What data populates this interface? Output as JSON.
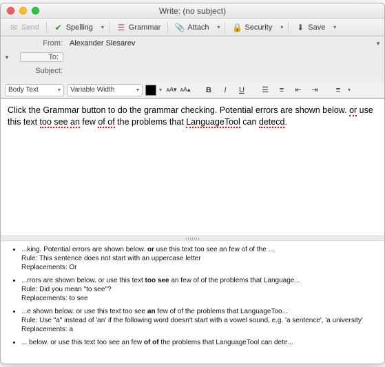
{
  "window": {
    "title": "Write: (no subject)"
  },
  "toolbar": {
    "send": "Send",
    "spelling": "Spelling",
    "grammar": "Grammar",
    "attach": "Attach",
    "security": "Security",
    "save": "Save"
  },
  "headers": {
    "from_label": "From:",
    "from_value": "Alexander Slesarev",
    "to_label": "To:",
    "to_value": "",
    "subject_label": "Subject:",
    "subject_value": ""
  },
  "formatbar": {
    "para_style": "Body Text",
    "font_family": "Variable Width"
  },
  "body": {
    "line1_a": "Click the Grammar button to do the grammar checking. Potential errors are shown below. ",
    "line2_a": "or",
    "line2_b": " use this text ",
    "line2_c": "too see",
    "line2_d": " ",
    "line2_e": "an",
    "line2_f": " few ",
    "line2_g": "of of",
    "line2_h": " the problems that ",
    "line2_i": "LanguageTool",
    "line2_j": " can ",
    "line2_k": "detecd",
    "line2_l": "."
  },
  "issues": [
    {
      "pre": "...king. Potential errors are shown below. ",
      "hl": "or",
      "post": " use this text too see an few of of the ...",
      "rule": "Rule: This sentence does not start with an uppercase letter",
      "repl": "Replacements: Or"
    },
    {
      "pre": "...rrors are shown below. or use this text ",
      "hl": "too see",
      "post": " an few of of the problems that Language...",
      "rule": "Rule: Did you mean \"to see\"?",
      "repl": "Replacements: to see"
    },
    {
      "pre": "...e shown below. or use this text too see ",
      "hl": "an",
      "post": " few of of the problems that LanguageToo...",
      "rule": "Rule: Use \"a\" instead of 'an' if the following word doesn't start with a vowel sound, e.g. 'a sentence', 'a university'",
      "repl": "Replacements: a"
    },
    {
      "pre": "... below. or use this text too see an few ",
      "hl": "of of",
      "post": " the problems that LanguageTool can dete...",
      "rule": "",
      "repl": ""
    }
  ]
}
